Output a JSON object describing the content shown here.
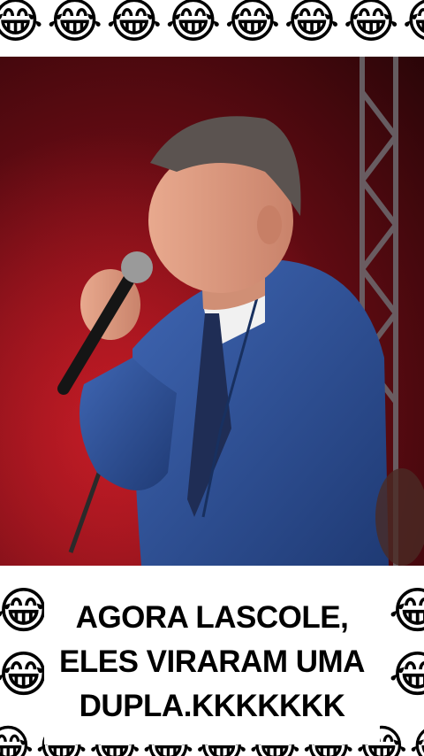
{
  "emoji": {
    "glyph": "😂",
    "top_row": "😂😂😂😂😂😂😂😂",
    "bottom_row": "😂😂😂😂😂😂😂😂😂"
  },
  "caption": {
    "line1": "AGORA LASCOLE,",
    "line2": "ELES VIRARAM UMA",
    "line3": "DUPLA.KKKKKKK"
  },
  "colors": {
    "stage_red": "#a4121c",
    "suit_blue": "#2c4f93",
    "caption_text": "#000000"
  }
}
